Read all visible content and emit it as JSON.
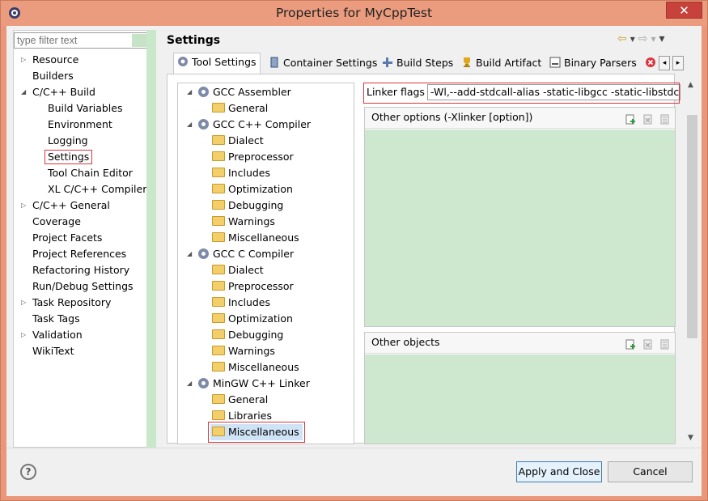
{
  "window": {
    "title": "Properties for MyCppTest",
    "close_glyph": "✕"
  },
  "filter": {
    "placeholder": "type filter text"
  },
  "nav_tree": [
    {
      "label": "Resource",
      "expander": "▷",
      "indent": 0
    },
    {
      "label": "Builders",
      "expander": "",
      "indent": 0
    },
    {
      "label": "C/C++ Build",
      "expander": "◢",
      "indent": 0
    },
    {
      "label": "Build Variables",
      "expander": "",
      "indent": 1
    },
    {
      "label": "Environment",
      "expander": "",
      "indent": 1
    },
    {
      "label": "Logging",
      "expander": "",
      "indent": 1
    },
    {
      "label": "Settings",
      "expander": "",
      "indent": 1,
      "selected": true
    },
    {
      "label": "Tool Chain Editor",
      "expander": "",
      "indent": 1
    },
    {
      "label": "XL C/C++ Compiler",
      "expander": "",
      "indent": 1
    },
    {
      "label": "C/C++ General",
      "expander": "▷",
      "indent": 0
    },
    {
      "label": "Coverage",
      "expander": "",
      "indent": 0
    },
    {
      "label": "Project Facets",
      "expander": "",
      "indent": 0
    },
    {
      "label": "Project References",
      "expander": "",
      "indent": 0
    },
    {
      "label": "Refactoring History",
      "expander": "",
      "indent": 0
    },
    {
      "label": "Run/Debug Settings",
      "expander": "",
      "indent": 0
    },
    {
      "label": "Task Repository",
      "expander": "▷",
      "indent": 0
    },
    {
      "label": "Task Tags",
      "expander": "",
      "indent": 0
    },
    {
      "label": "Validation",
      "expander": "▷",
      "indent": 0
    },
    {
      "label": "WikiText",
      "expander": "",
      "indent": 0
    }
  ],
  "page_title": "Settings",
  "nav_icons": {
    "back": "⇦",
    "back_menu": "▾",
    "forward": "⇨",
    "forward_menu": "▾",
    "view_menu": "▾"
  },
  "tabs": [
    {
      "label": "Tool Settings",
      "icon": "gear-icon",
      "active": true
    },
    {
      "label": "Container Settings",
      "icon": "container-icon"
    },
    {
      "label": "Build Steps",
      "icon": "build-steps-icon"
    },
    {
      "label": "Build Artifact",
      "icon": "trophy-icon"
    },
    {
      "label": "Binary Parsers",
      "icon": "binary-icon"
    }
  ],
  "tab_scroll": {
    "left": "◂",
    "right": "▸"
  },
  "tool_tree": [
    {
      "label": "GCC Assembler",
      "type": "tool",
      "expander": "◢"
    },
    {
      "label": "General",
      "type": "category"
    },
    {
      "label": "GCC C++ Compiler",
      "type": "tool",
      "expander": "◢"
    },
    {
      "label": "Dialect",
      "type": "category"
    },
    {
      "label": "Preprocessor",
      "type": "category"
    },
    {
      "label": "Includes",
      "type": "category"
    },
    {
      "label": "Optimization",
      "type": "category"
    },
    {
      "label": "Debugging",
      "type": "category"
    },
    {
      "label": "Warnings",
      "type": "category"
    },
    {
      "label": "Miscellaneous",
      "type": "category"
    },
    {
      "label": "GCC C Compiler",
      "type": "tool",
      "expander": "◢"
    },
    {
      "label": "Dialect",
      "type": "category"
    },
    {
      "label": "Preprocessor",
      "type": "category"
    },
    {
      "label": "Includes",
      "type": "category"
    },
    {
      "label": "Optimization",
      "type": "category"
    },
    {
      "label": "Debugging",
      "type": "category"
    },
    {
      "label": "Warnings",
      "type": "category"
    },
    {
      "label": "Miscellaneous",
      "type": "category"
    },
    {
      "label": "MinGW C++ Linker",
      "type": "tool",
      "expander": "◢"
    },
    {
      "label": "General",
      "type": "category"
    },
    {
      "label": "Libraries",
      "type": "category"
    },
    {
      "label": "Miscellaneous",
      "type": "category",
      "selected": true
    }
  ],
  "linker_flags": {
    "label": "Linker flags",
    "value": "-Wl,--add-stdcall-alias -static-libgcc -static-libstdc++"
  },
  "other_options": {
    "label": "Other options (-Xlinker [option])"
  },
  "other_objects": {
    "label": "Other objects"
  },
  "buttons": {
    "apply_close": "Apply and Close",
    "cancel": "Cancel",
    "help": "?"
  },
  "colors": {
    "title_bar": "#eb9c7e",
    "close_button": "#c7423a",
    "highlight_box": "#d9363e",
    "list_bg": "#cde8cf"
  }
}
